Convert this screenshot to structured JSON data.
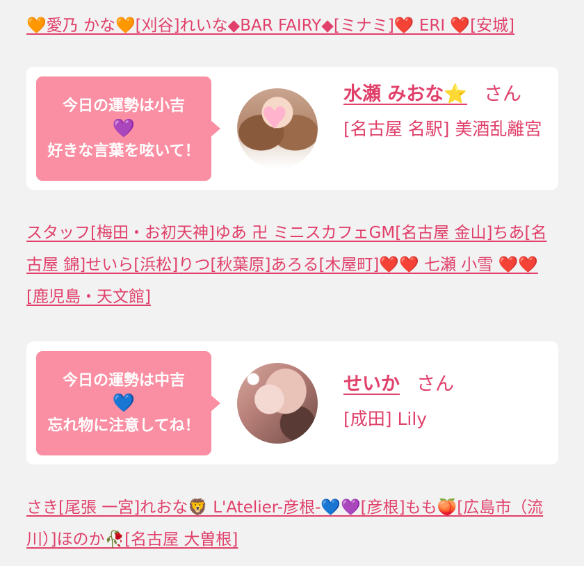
{
  "link_block_1": [
    {
      "text": "🧡愛乃 かな🧡[刈谷]"
    },
    {
      "text": "れいな◆BAR FAIRY◆[ミナミ]"
    },
    {
      "text": "❤️ ERI ❤️[安城]"
    }
  ],
  "card_1": {
    "fortune_line": "今日の運勢は小吉",
    "heart": "💜",
    "advice": "好きな言葉を呟いて！",
    "avatar_label": "水瀬 みおな avatar",
    "name": "水瀬 みおな⭐",
    "honorific": "さん",
    "shop": "[名古屋 名駅] 美酒乱離宮"
  },
  "link_block_2": [
    {
      "text": "スタッフ[梅田・お初天神]"
    },
    {
      "text": "ゆあ 卍 ミニスカフェGM[名古屋 金山]"
    },
    {
      "text": "ちあ[名古屋 錦]"
    },
    {
      "text": "せいら[浜松]"
    },
    {
      "text": "りつ[秋葉原]"
    },
    {
      "text": "あろる[木屋町]"
    },
    {
      "text": "❤️❤️ 七瀬 小雪 ❤️❤️[鹿児島・天文館]"
    }
  ],
  "card_2": {
    "fortune_line": "今日の運勢は中吉",
    "heart": "💙",
    "advice": "忘れ物に注意してね！",
    "avatar_label": "せいか avatar",
    "name": "せいか",
    "honorific": "さん",
    "shop": "[成田] Lily"
  },
  "link_block_3": [
    {
      "text": "さき[尾張 一宮]"
    },
    {
      "text": "れおな🦁 L'Atelier-彦根-💙💜[彦根]"
    },
    {
      "text": "もも🍑[広島市（流川）]"
    },
    {
      "text": "ほのか🥀[名古屋 大曽根]"
    }
  ],
  "colors": {
    "accent": "#e0406a",
    "bubble": "#fa8ea2",
    "background": "#f2f2f2",
    "card": "#ffffff"
  }
}
